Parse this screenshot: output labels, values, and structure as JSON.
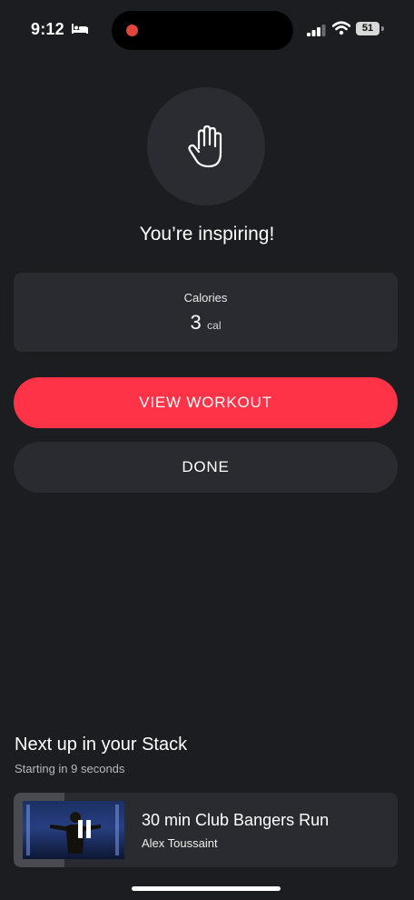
{
  "status_bar": {
    "time": "9:12",
    "battery": "51",
    "icons": [
      "bed-icon",
      "signal-icon",
      "wifi-icon",
      "battery-icon"
    ]
  },
  "summary": {
    "icon": "hand-wave-icon",
    "headline": "You’re inspiring!",
    "stat": {
      "label": "Calories",
      "value": "3",
      "unit": "cal"
    }
  },
  "actions": {
    "view_workout": "VIEW WORKOUT",
    "done": "DONE"
  },
  "next_up": {
    "title": "Next up in your Stack",
    "subtitle": "Starting in 9 seconds",
    "class_name": "30 min Club Bangers Run",
    "instructor": "Alex Toussaint",
    "icon": "pause-icon"
  },
  "colors": {
    "background": "#1c1d20",
    "card": "#2a2b30",
    "accent": "#ff3347",
    "recording": "#e0443c"
  }
}
